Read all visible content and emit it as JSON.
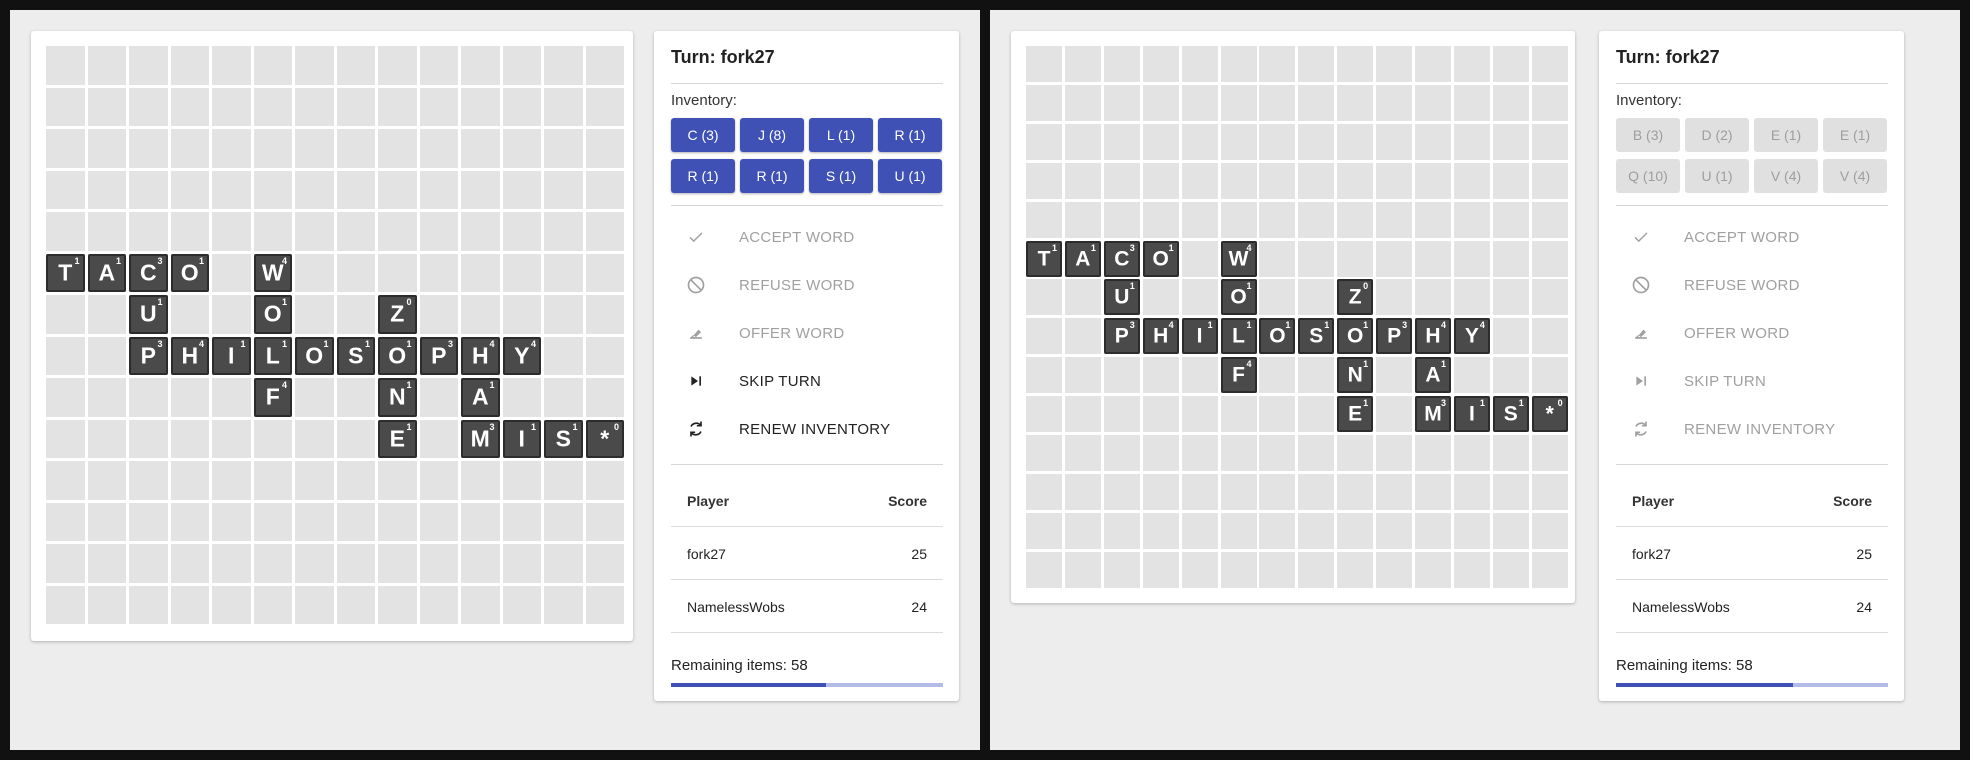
{
  "panels": [
    {
      "id": "left",
      "turn_title": "Turn: fork27",
      "inventory_label": "Inventory:",
      "inventory": [
        {
          "label": "C (3)"
        },
        {
          "label": "J (8)"
        },
        {
          "label": "L (1)"
        },
        {
          "label": "R (1)"
        },
        {
          "label": "R (1)"
        },
        {
          "label": "R (1)"
        },
        {
          "label": "S (1)"
        },
        {
          "label": "U (1)"
        }
      ],
      "inventory_enabled": true,
      "actions": [
        {
          "label": "ACCEPT WORD",
          "icon": "check-icon",
          "enabled": false
        },
        {
          "label": "REFUSE WORD",
          "icon": "block-icon",
          "enabled": false
        },
        {
          "label": "OFFER WORD",
          "icon": "eraser-icon",
          "enabled": false
        },
        {
          "label": "SKIP TURN",
          "icon": "skip-next-icon",
          "enabled": true
        },
        {
          "label": "RENEW INVENTORY",
          "icon": "refresh-icon",
          "enabled": true
        }
      ],
      "score_headers": {
        "player": "Player",
        "score": "Score"
      },
      "scores": [
        {
          "player": "fork27",
          "score": "25"
        },
        {
          "player": "NamelessWobs",
          "score": "24"
        }
      ],
      "remaining_text": "Remaining items: 58",
      "remaining_progress": 0.57,
      "board": {
        "cols": 14,
        "rows": 14,
        "tiles": [
          {
            "r": 5,
            "c": 0,
            "l": "T",
            "p": "1"
          },
          {
            "r": 5,
            "c": 1,
            "l": "A",
            "p": "1"
          },
          {
            "r": 5,
            "c": 2,
            "l": "C",
            "p": "3"
          },
          {
            "r": 5,
            "c": 3,
            "l": "O",
            "p": "1"
          },
          {
            "r": 5,
            "c": 5,
            "l": "W",
            "p": "4"
          },
          {
            "r": 6,
            "c": 2,
            "l": "U",
            "p": "1"
          },
          {
            "r": 6,
            "c": 5,
            "l": "O",
            "p": "1"
          },
          {
            "r": 6,
            "c": 8,
            "l": "Z",
            "p": "0"
          },
          {
            "r": 7,
            "c": 2,
            "l": "P",
            "p": "3"
          },
          {
            "r": 7,
            "c": 3,
            "l": "H",
            "p": "4"
          },
          {
            "r": 7,
            "c": 4,
            "l": "I",
            "p": "1"
          },
          {
            "r": 7,
            "c": 5,
            "l": "L",
            "p": "1"
          },
          {
            "r": 7,
            "c": 6,
            "l": "O",
            "p": "1"
          },
          {
            "r": 7,
            "c": 7,
            "l": "S",
            "p": "1"
          },
          {
            "r": 7,
            "c": 8,
            "l": "O",
            "p": "1"
          },
          {
            "r": 7,
            "c": 9,
            "l": "P",
            "p": "3"
          },
          {
            "r": 7,
            "c": 10,
            "l": "H",
            "p": "4"
          },
          {
            "r": 7,
            "c": 11,
            "l": "Y",
            "p": "4"
          },
          {
            "r": 8,
            "c": 5,
            "l": "F",
            "p": "4"
          },
          {
            "r": 8,
            "c": 8,
            "l": "N",
            "p": "1"
          },
          {
            "r": 8,
            "c": 10,
            "l": "A",
            "p": "1"
          },
          {
            "r": 9,
            "c": 8,
            "l": "E",
            "p": "1"
          },
          {
            "r": 9,
            "c": 10,
            "l": "M",
            "p": "3"
          },
          {
            "r": 9,
            "c": 11,
            "l": "I",
            "p": "1"
          },
          {
            "r": 9,
            "c": 12,
            "l": "S",
            "p": "1"
          },
          {
            "r": 9,
            "c": 13,
            "l": "*",
            "p": "0"
          }
        ]
      }
    },
    {
      "id": "right",
      "turn_title": "Turn: fork27",
      "inventory_label": "Inventory:",
      "inventory": [
        {
          "label": "B (3)"
        },
        {
          "label": "D (2)"
        },
        {
          "label": "E (1)"
        },
        {
          "label": "E (1)"
        },
        {
          "label": "Q (10)"
        },
        {
          "label": "U (1)"
        },
        {
          "label": "V (4)"
        },
        {
          "label": "V (4)"
        }
      ],
      "inventory_enabled": false,
      "actions": [
        {
          "label": "ACCEPT WORD",
          "icon": "check-icon",
          "enabled": false
        },
        {
          "label": "REFUSE WORD",
          "icon": "block-icon",
          "enabled": false
        },
        {
          "label": "OFFER WORD",
          "icon": "eraser-icon",
          "enabled": false
        },
        {
          "label": "SKIP TURN",
          "icon": "skip-next-icon",
          "enabled": false
        },
        {
          "label": "RENEW INVENTORY",
          "icon": "refresh-icon",
          "enabled": false
        }
      ],
      "score_headers": {
        "player": "Player",
        "score": "Score"
      },
      "scores": [
        {
          "player": "fork27",
          "score": "25"
        },
        {
          "player": "NamelessWobs",
          "score": "24"
        }
      ],
      "remaining_text": "Remaining items: 58",
      "remaining_progress": 0.65,
      "board": {
        "cols": 14,
        "rows": 14,
        "tiles": [
          {
            "r": 5,
            "c": 0,
            "l": "T",
            "p": "1"
          },
          {
            "r": 5,
            "c": 1,
            "l": "A",
            "p": "1"
          },
          {
            "r": 5,
            "c": 2,
            "l": "C",
            "p": "3"
          },
          {
            "r": 5,
            "c": 3,
            "l": "O",
            "p": "1"
          },
          {
            "r": 5,
            "c": 5,
            "l": "W",
            "p": "4"
          },
          {
            "r": 6,
            "c": 2,
            "l": "U",
            "p": "1"
          },
          {
            "r": 6,
            "c": 5,
            "l": "O",
            "p": "1"
          },
          {
            "r": 6,
            "c": 8,
            "l": "Z",
            "p": "0"
          },
          {
            "r": 7,
            "c": 2,
            "l": "P",
            "p": "3"
          },
          {
            "r": 7,
            "c": 3,
            "l": "H",
            "p": "4"
          },
          {
            "r": 7,
            "c": 4,
            "l": "I",
            "p": "1"
          },
          {
            "r": 7,
            "c": 5,
            "l": "L",
            "p": "1"
          },
          {
            "r": 7,
            "c": 6,
            "l": "O",
            "p": "1"
          },
          {
            "r": 7,
            "c": 7,
            "l": "S",
            "p": "1"
          },
          {
            "r": 7,
            "c": 8,
            "l": "O",
            "p": "1"
          },
          {
            "r": 7,
            "c": 9,
            "l": "P",
            "p": "3"
          },
          {
            "r": 7,
            "c": 10,
            "l": "H",
            "p": "4"
          },
          {
            "r": 7,
            "c": 11,
            "l": "Y",
            "p": "4"
          },
          {
            "r": 8,
            "c": 5,
            "l": "F",
            "p": "4"
          },
          {
            "r": 8,
            "c": 8,
            "l": "N",
            "p": "1"
          },
          {
            "r": 8,
            "c": 10,
            "l": "A",
            "p": "1"
          },
          {
            "r": 9,
            "c": 8,
            "l": "E",
            "p": "1"
          },
          {
            "r": 9,
            "c": 10,
            "l": "M",
            "p": "3"
          },
          {
            "r": 9,
            "c": 11,
            "l": "I",
            "p": "1"
          },
          {
            "r": 9,
            "c": 12,
            "l": "S",
            "p": "1"
          },
          {
            "r": 9,
            "c": 13,
            "l": "*",
            "p": "0"
          }
        ]
      }
    }
  ]
}
